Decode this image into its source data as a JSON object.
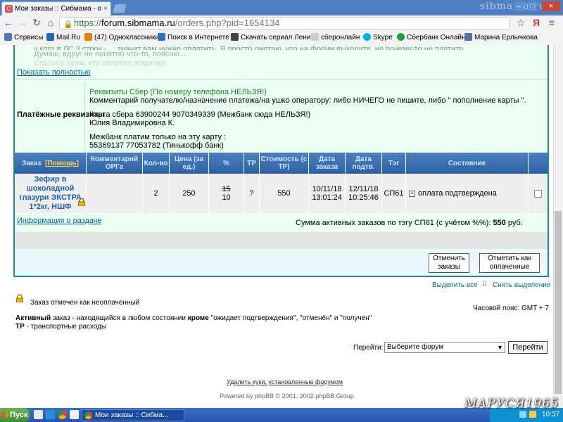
{
  "browser": {
    "tab_title": "Мои заказы :: Сибмама - о",
    "url_scheme": "https://",
    "url_host": "forum.sibmama.ru",
    "url_path": "/orders.php?pid=1654134",
    "watermark": "sibmama.ru",
    "bookmarks": [
      {
        "label": "Сервисы",
        "color": "#4a78c2"
      },
      {
        "label": "Mail.Ru",
        "color": "#2168b3"
      },
      {
        "label": "(47) Одноклассники",
        "color": "#ee8208"
      },
      {
        "label": "Поиск в Интернете",
        "color": "#2d74c5"
      },
      {
        "label": "Скачать сериал Ленин",
        "color": "#444444"
      },
      {
        "label": "сберонлайн",
        "color": "#cccccc"
      },
      {
        "label": "Skype",
        "color": "#00aff0"
      },
      {
        "label": "Сбербанк Онлайн",
        "color": "#21a038"
      },
      {
        "label": "Марина Ерлычкова",
        "color": "#4c75a3"
      }
    ]
  },
  "message": {
    "line1": "у кого в ЛС 3 строк - ... значит вам нужно оплатить. Я просто смотрю, что на форум выходите, но почему-то не платите.",
    "line2": "Думаю, вдруг не понятно что-то, поясню....",
    "line3": "Спасибо всем, кто оплатил вовремя!",
    "show_full": "Показать полностью"
  },
  "payment": {
    "label": "Платёжные реквизиты",
    "title": "Реквизиты Сбер (По номеру телефона НЕЛЬЗЯ!)",
    "comment": "Комментарий получателю/назначение платежа/на ушко оператору: либо НИЧЕГО не пишите, либо \" пополнение карты \".",
    "card_line": "Карта сбера 63900244 9070349339 (Межбанк сюда НЕЛЬЗЯ!)",
    "name_line": "Юлия Владимировна К.",
    "mezhbank_line": "Межбанк платим только на эту карту :",
    "tinkoff_line": "55369137 77053782 (Тинькофф банк)"
  },
  "table": {
    "headers": {
      "order": "Заказ",
      "help": "[Помощь]",
      "comment": "Комментарий ОРГа",
      "qty": "Кол-во",
      "price": "Цена (за ед.)",
      "percent": "%",
      "tr": "ТР",
      "cost": "Стоимость (с ТР)",
      "order_date": "Дата заказа",
      "confirm_date": "Дата подтв.",
      "tag": "Тэг",
      "status": "Состояние"
    },
    "row": {
      "product": "Зефир в шоколадной глазури ЭКСТРА 1*2кг, НШФ",
      "comment": "",
      "qty": "2",
      "price": "250",
      "percent_old": "15",
      "percent_new": "10",
      "tr": "?",
      "cost": "550",
      "order_date": "10/11/18 13:01:24",
      "confirm_date": "12/11/18 10:25:46",
      "tag": "СП61",
      "status": "оплата подтверждена"
    },
    "info_link": "Информация о раздаче",
    "sum_label": "Сумма активных заказов по тэгу СП61 (с учётом %%):",
    "sum_value": "550",
    "sum_currency": "руб."
  },
  "buttons": {
    "cancel": "Отменить заказы",
    "mark_paid": "Отметить как оплаченные",
    "select_all": "Выделить все",
    "deselect": "Снять выделение"
  },
  "legend": {
    "unpaid": "Заказ отмечен как неоплаченный",
    "timezone": "Часовой пояс: GMT + 7",
    "active_term": "Активный",
    "active_desc_1": "заказ - находящийся в любом состоянии",
    "active_kw": "кроме",
    "active_desc_2": "\"ожидает подтверждения\", \"отменён\" и \"получен\"",
    "tr_term": "ТР",
    "tr_desc": "- транспортные расходы"
  },
  "footer": {
    "goto_label": "Перейти:",
    "goto_select": "Выберите форум",
    "goto_button": "Перейти",
    "delete_cookies": "Удалить куки, установленные форумом",
    "powered_by": "Powered by phpBB © 2001, 2002 phpBB Group"
  },
  "taskbar": {
    "start": "Пуск",
    "window": "Мои заказы :: Сибма...",
    "clock": "10:37",
    "signature": "МАРУСЯ1965"
  }
}
